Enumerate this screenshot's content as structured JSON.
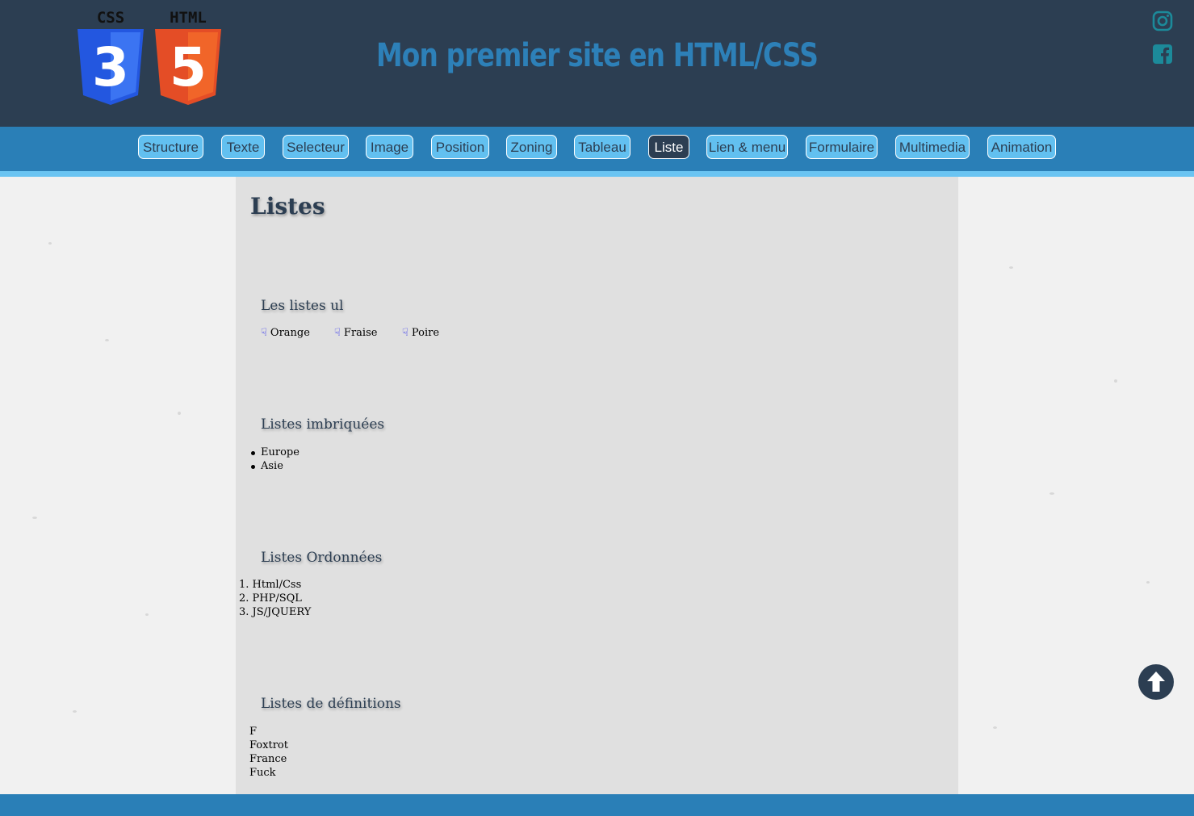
{
  "header": {
    "logo_css_text": "CSS",
    "logo_html_text": "HTML",
    "logo_css_number": "3",
    "logo_html_number": "5",
    "title": "Mon premier site en HTML/CSS",
    "social_icons": [
      "instagram-icon",
      "facebook-icon"
    ],
    "colors": {
      "background": "#2c3e52",
      "title": "#2d80b8",
      "social": "#1c8a9a"
    }
  },
  "nav": {
    "items": [
      {
        "label": "Structure"
      },
      {
        "label": "Texte"
      },
      {
        "label": "Selecteur"
      },
      {
        "label": "Image"
      },
      {
        "label": "Position"
      },
      {
        "label": "Zoning"
      },
      {
        "label": "Tableau"
      },
      {
        "label": "Liste"
      },
      {
        "label": "Lien & menu"
      },
      {
        "label": "Formulaire"
      },
      {
        "label": "Multimedia"
      },
      {
        "label": "Animation"
      }
    ],
    "active": "Liste",
    "colors": {
      "bar": "#2a7fb7",
      "item": "#62c0f0",
      "active": "#2c3e52"
    }
  },
  "main": {
    "title": "Listes",
    "ul_section": {
      "title": "Les listes ul",
      "items": [
        "Orange",
        "Fraise",
        "Poire"
      ],
      "bullet_icon": "hand-icon"
    },
    "nested_section": {
      "title": "Listes imbriquées",
      "items": [
        "Europe",
        "Asie"
      ]
    },
    "ordered_section": {
      "title": "Listes Ordonnées",
      "items": [
        "1. Html/Css",
        "2. PHP/SQL",
        "3. JS/JQUERY"
      ]
    },
    "definition_section": {
      "title": "Listes de définitions",
      "items": [
        "F",
        "Foxtrot",
        "France",
        "Fuck"
      ]
    }
  },
  "back_to_top_icon": "arrow-up-circle-icon",
  "footer": {
    "color": "#2a7fb7"
  }
}
